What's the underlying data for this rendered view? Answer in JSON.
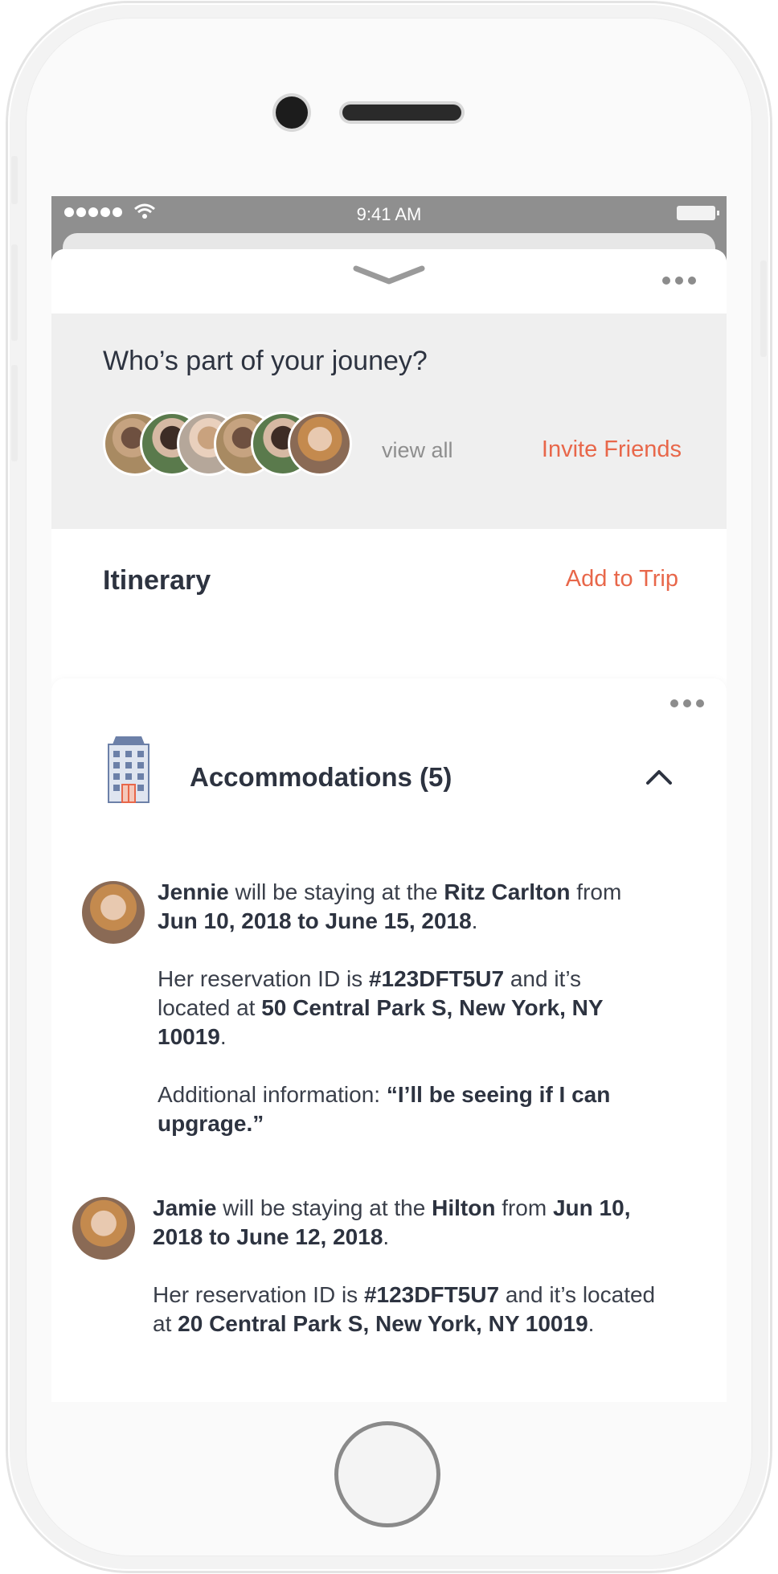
{
  "status_bar": {
    "time": "9:41 AM"
  },
  "friends": {
    "title": "Who’s part of your jouney?",
    "view_all": "view all",
    "invite": "Invite Friends",
    "avatar_count": 6
  },
  "itinerary": {
    "title": "Itinerary",
    "add_to_trip": "Add to Trip"
  },
  "accommodations": {
    "title": "Accommodations (5)",
    "entries": [
      {
        "name": "Jennie",
        "t1": " will be staying at the ",
        "hotel": "Ritz Carlton",
        "t2": " from ",
        "dates": "Jun 10, 2018 to June 15, 2018",
        "t3": ".",
        "res_prefix": "Her reservation ID is ",
        "res_id": "#123DFT5U7",
        "res_mid": " and it’s located at ",
        "address": "50 Central Park S, New York, NY 10019",
        "res_end": ".",
        "info_prefix": "Additional information: ",
        "info": "“I’ll be seeing if I can upgrage.”"
      },
      {
        "name": "Jamie",
        "t1": " will be staying at the ",
        "hotel": "Hilton",
        "t2": " from ",
        "dates": "Jun 10, 2018 to June 12, 2018",
        "t3": ".",
        "res_prefix": "Her reservation ID is ",
        "res_id": "#123DFT5U7",
        "res_mid": " and it’s located at ",
        "address": "20 Central Park S, New York, NY 10019",
        "res_end": "."
      }
    ]
  },
  "colors": {
    "accent": "#e8674a",
    "text_dark": "#2d3340",
    "status_bar": "#8f8f8f",
    "panel_grey": "#efefef"
  }
}
